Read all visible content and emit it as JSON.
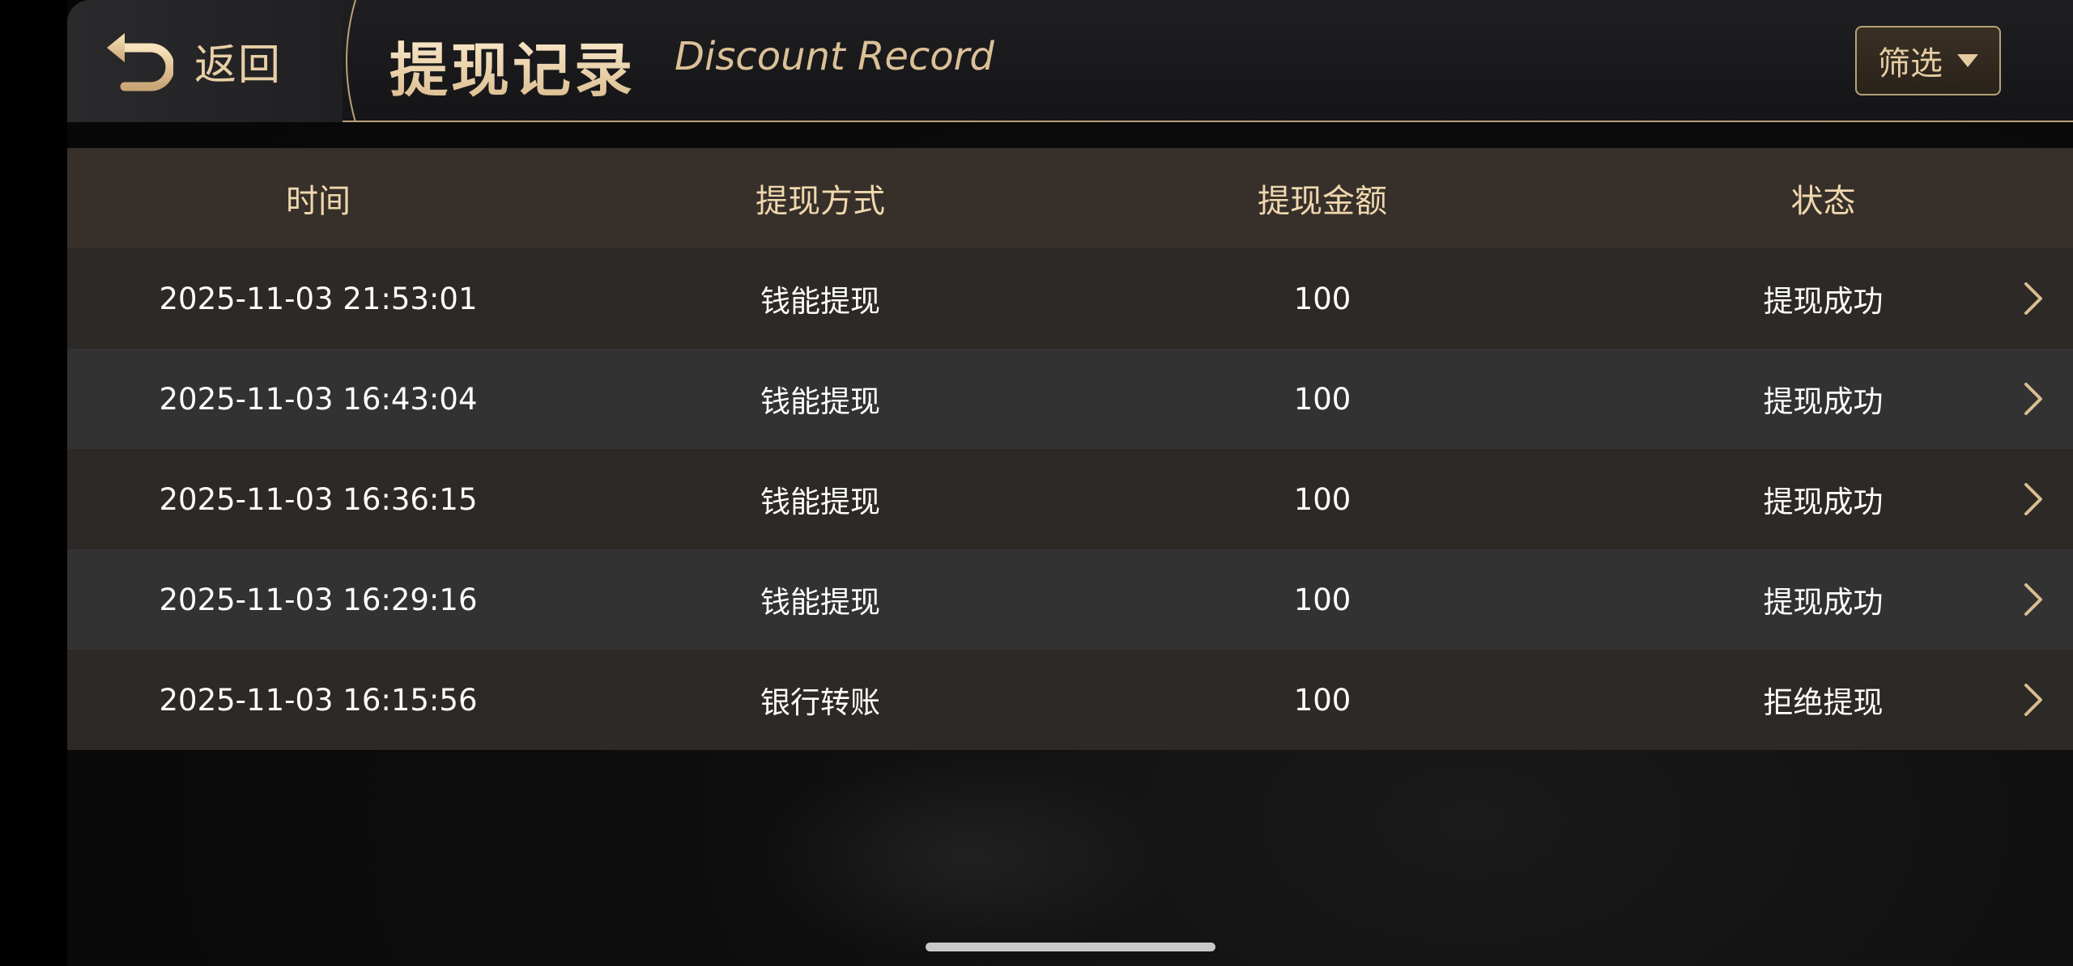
{
  "header": {
    "back_label": "返回",
    "title_cn": "提现记录",
    "title_en": "Discount Record",
    "filter_label": "筛选"
  },
  "table": {
    "columns": [
      "时间",
      "提现方式",
      "提现金额",
      "状态"
    ],
    "rows": [
      {
        "time": "2025-11-03 21:53:01",
        "method": "钱能提现",
        "amount": "100",
        "status": "提现成功"
      },
      {
        "time": "2025-11-03 16:43:04",
        "method": "钱能提现",
        "amount": "100",
        "status": "提现成功"
      },
      {
        "time": "2025-11-03 16:36:15",
        "method": "钱能提现",
        "amount": "100",
        "status": "提现成功"
      },
      {
        "time": "2025-11-03 16:29:16",
        "method": "钱能提现",
        "amount": "100",
        "status": "提现成功"
      },
      {
        "time": "2025-11-03 16:15:56",
        "method": "银行转账",
        "amount": "100",
        "status": "拒绝提现"
      }
    ]
  },
  "icons": {
    "back": "back-arrow-icon",
    "filter_caret": "caret-down-icon",
    "row_chevron": "chevron-right-icon"
  },
  "colors": {
    "accent_gold": "#e8cfa6",
    "border_gold": "#b8a07a",
    "header_row_bg": "#37302a",
    "row_odd_bg": "#2c2926",
    "row_even_bg": "#333233"
  }
}
